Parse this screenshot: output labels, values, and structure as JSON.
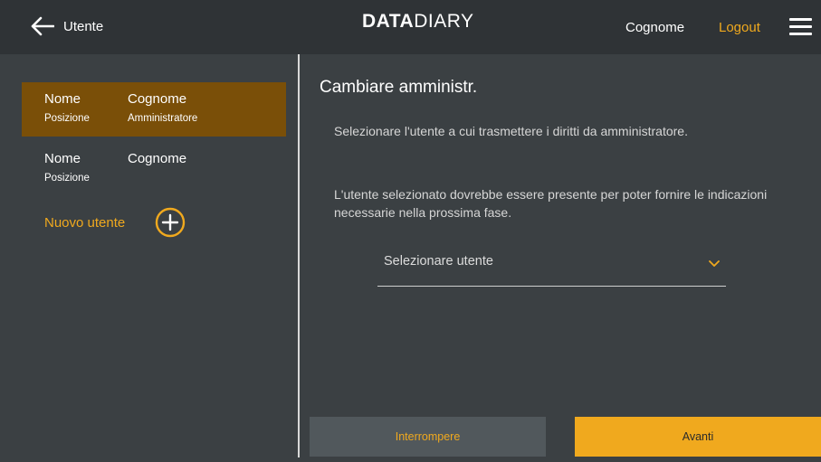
{
  "header": {
    "back_label": "Utente",
    "logo_bold": "DATA",
    "logo_thin": "DIARY",
    "user_name": "Cognome",
    "logout_label": "Logout"
  },
  "sidebar": {
    "users": [
      {
        "name": "Nome",
        "surname": "Cognome",
        "position": "Posizione",
        "role": "Amministratore",
        "selected": true
      },
      {
        "name": "Nome",
        "surname": "Cognome",
        "position": "Posizione",
        "role": "",
        "selected": false
      }
    ],
    "new_user_label": "Nuovo utente"
  },
  "panel": {
    "title": "Cambiare amministr.",
    "instruction": "Selezionare l'utente a cui trasmettere i diritti da amministratore.",
    "note": "L'utente selezionato dovrebbe essere presente per poter fornire le indicazioni necessarie nella prossima fase.",
    "select_placeholder": "Selezionare utente",
    "cancel_label": "Interrompere",
    "next_label": "Avanti"
  },
  "colors": {
    "accent": "#f0a91e",
    "selected_row": "#7a4f08",
    "background": "#3b4043",
    "header": "#2f3336"
  },
  "icons": [
    "arrow-left-icon",
    "hamburger-menu-icon",
    "plus-circle-icon",
    "chevron-down-icon"
  ]
}
